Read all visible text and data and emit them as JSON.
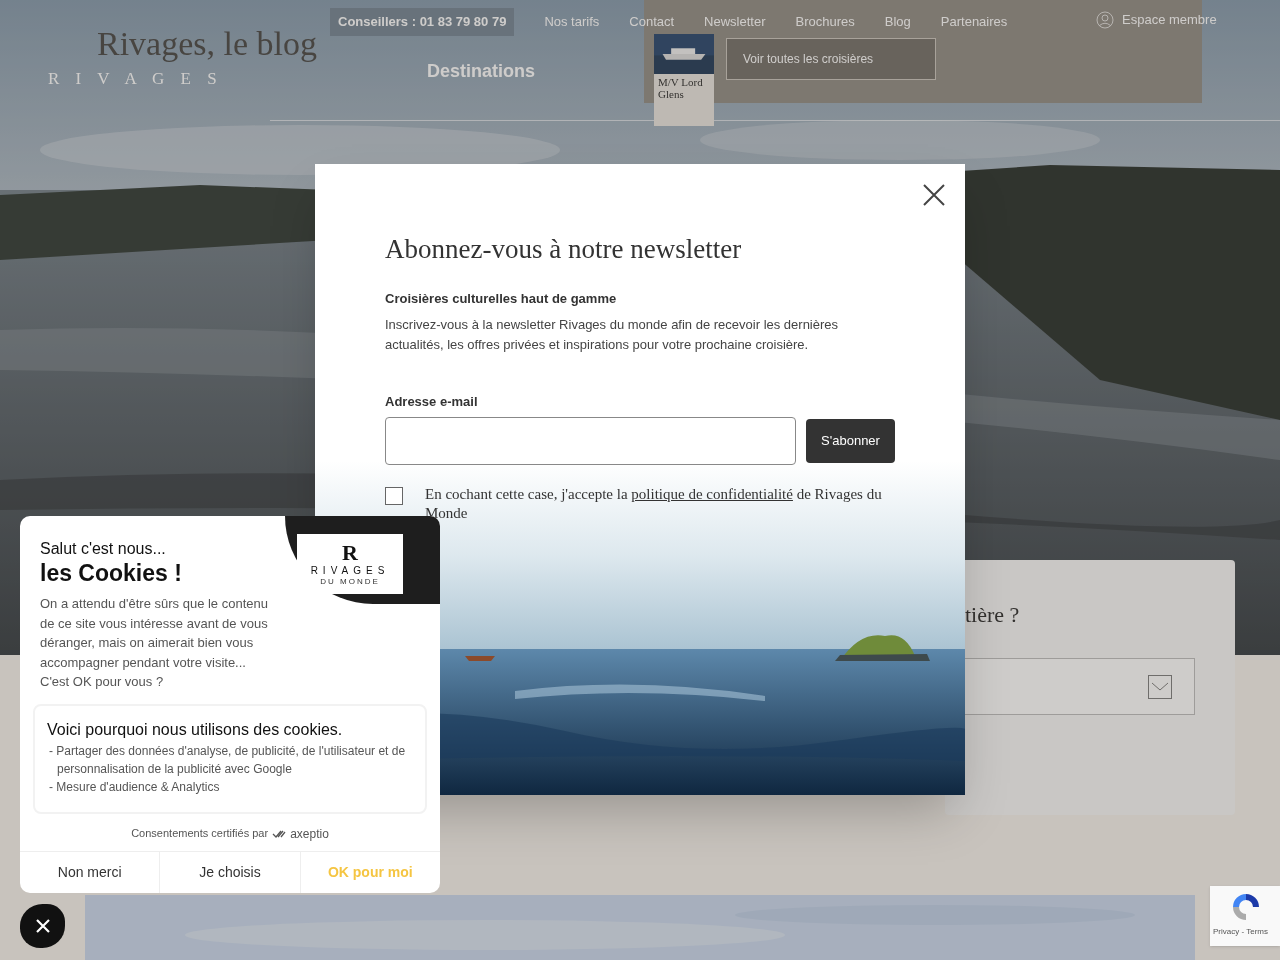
{
  "header": {
    "logo_title": "Rivages, le blog",
    "logo_subtitle": "R I V A G E S",
    "phone": "Conseillers : 01 83 79 80 79",
    "nav": [
      "Nos tarifs",
      "Contact",
      "Newsletter",
      "Brochures",
      "Blog",
      "Partenaires"
    ],
    "member": "Espace membre",
    "menu": [
      "Destinations"
    ],
    "mega": {
      "ship": "M/V Lord Glens",
      "see_all": "Voir toutes les croisières"
    }
  },
  "background_card": {
    "title_fragment": "tière ?"
  },
  "newsletter": {
    "title": "Abonnez-vous à notre newsletter",
    "subtitle": "Croisières culturelles haut de gamme",
    "description": "Inscrivez-vous à la newsletter Rivages du monde afin de recevoir les dernières actualités, les offres privées et inspirations pour votre prochaine croisière.",
    "email_label": "Adresse e-mail",
    "submit": "S'abonner",
    "consent": {
      "checked": false,
      "text": "En cochant cette case, j'accepte la ",
      "link": "politique de confidentialité",
      "text_after": " de Rivages du Monde"
    }
  },
  "cookies": {
    "greeting": "Salut c'est nous...",
    "title": "les Cookies !",
    "logo": {
      "mark": "R",
      "name": "RIVAGES",
      "tagline": "DU MONDE"
    },
    "intro": "On a attendu d'être sûrs que le contenu de ce site vous intéresse avant de vous déranger, mais on aimerait bien vous accompagner pendant votre visite...",
    "question": "C'est OK pour vous ?",
    "purposes_title": "Voici pourquoi nous utilisons des cookies.",
    "purposes": [
      "- Partager des données d'analyse, de publicité, de l'utilisateur et de personnalisation de la publicité avec Google",
      "- Mesure d'audience & Analytics"
    ],
    "certified": "Consentements certifiés par",
    "brand": "axeptio",
    "buttons": [
      {
        "label": "Non merci",
        "kind": "refuse"
      },
      {
        "label": "Je choisis",
        "kind": "choose"
      },
      {
        "label": "OK pour moi",
        "kind": "accept"
      }
    ]
  },
  "recaptcha": {
    "links": "Privacy - Terms"
  }
}
